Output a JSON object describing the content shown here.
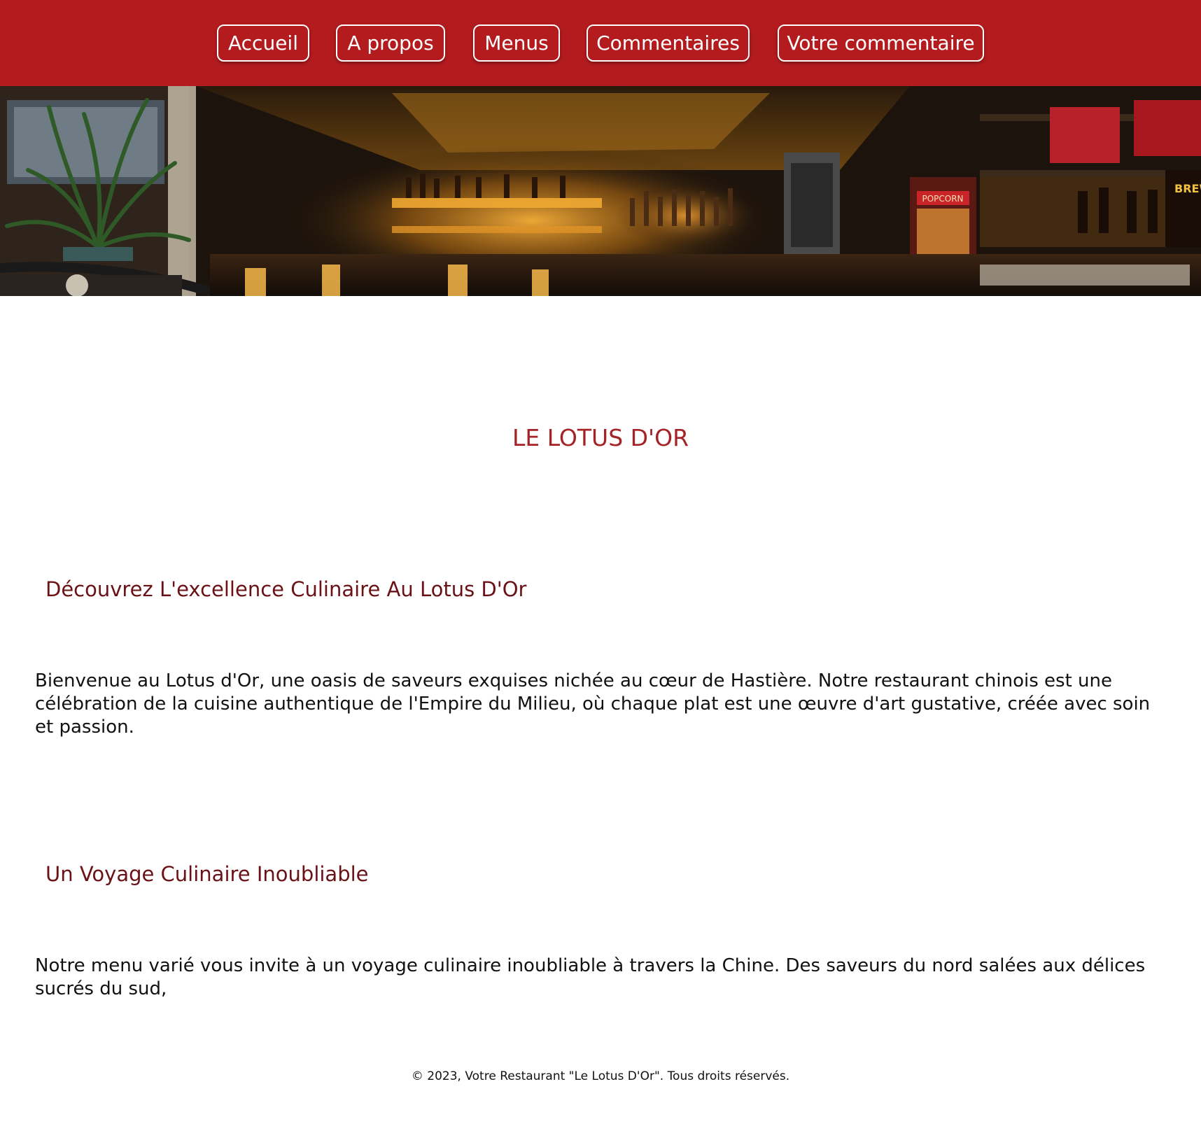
{
  "nav": {
    "items": [
      {
        "label": "Accueil"
      },
      {
        "label": "A propos"
      },
      {
        "label": "Menus"
      },
      {
        "label": "Commentaires"
      },
      {
        "label": "Votre commentaire"
      }
    ]
  },
  "hero": {
    "image": "restaurant-bar-interior",
    "sign_text": "BREW LIQUOR STORE",
    "popcorn_text": "POPCORN"
  },
  "main": {
    "site_title": "LE LOTUS D'OR",
    "sections": [
      {
        "heading": "Découvrez L'excellence Culinaire Au Lotus D'Or",
        "text": "Bienvenue au Lotus d'Or, une oasis de saveurs exquises nichée au cœur de Hastière. Notre restaurant chinois est une célébration de la cuisine authentique de l'Empire du Milieu, où chaque plat est une œuvre d'art gustative, créée avec soin et passion."
      },
      {
        "heading": "Un Voyage Culinaire Inoubliable",
        "text": "Notre menu varié vous invite à un voyage culinaire inoubliable à travers la Chine. Des saveurs du nord salées aux délices sucrés du sud,"
      }
    ]
  },
  "footer": {
    "text": "© 2023, Votre Restaurant \"Le Lotus D'Or\". Tous droits réservés."
  },
  "colors": {
    "nav_bg": "#b31b1e",
    "title": "#a52327",
    "heading": "#6b1216"
  }
}
